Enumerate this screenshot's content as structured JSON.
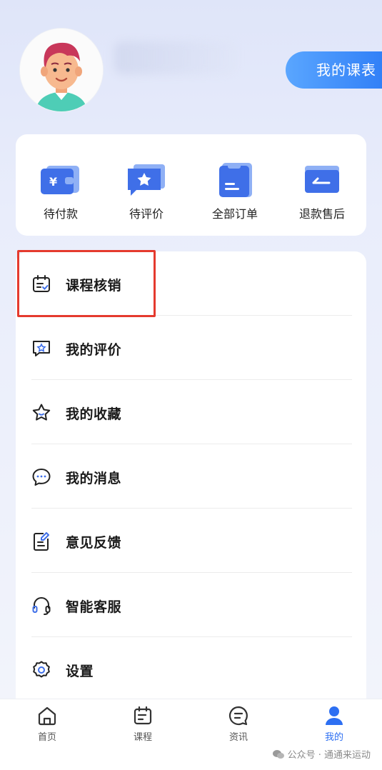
{
  "header": {
    "schedule_button": "我的课表"
  },
  "orders": [
    {
      "label": "待付款",
      "icon": "wallet-yen-icon"
    },
    {
      "label": "待评价",
      "icon": "star-chat-icon"
    },
    {
      "label": "全部订单",
      "icon": "clipboard-icon"
    },
    {
      "label": "退款售后",
      "icon": "refund-card-icon"
    }
  ],
  "menu": [
    {
      "label": "课程核销",
      "icon": "calendar-check-icon"
    },
    {
      "label": "我的评价",
      "icon": "star-message-icon"
    },
    {
      "label": "我的收藏",
      "icon": "star-icon"
    },
    {
      "label": "我的消息",
      "icon": "chat-dots-icon"
    },
    {
      "label": "意见反馈",
      "icon": "edit-document-icon"
    },
    {
      "label": "智能客服",
      "icon": "headset-icon"
    },
    {
      "label": "设置",
      "icon": "gear-icon"
    }
  ],
  "tabs": [
    {
      "label": "首页",
      "icon": "home-icon"
    },
    {
      "label": "课程",
      "icon": "calendar-icon"
    },
    {
      "label": "资讯",
      "icon": "news-chat-icon"
    },
    {
      "label": "我的",
      "icon": "user-icon",
      "active": true
    }
  ],
  "watermark": "公众号 · 通通来运动",
  "colors": {
    "accent": "#2d7cf6",
    "highlight_border": "#e53a2e",
    "icon_blue": "#3f6fe8"
  }
}
